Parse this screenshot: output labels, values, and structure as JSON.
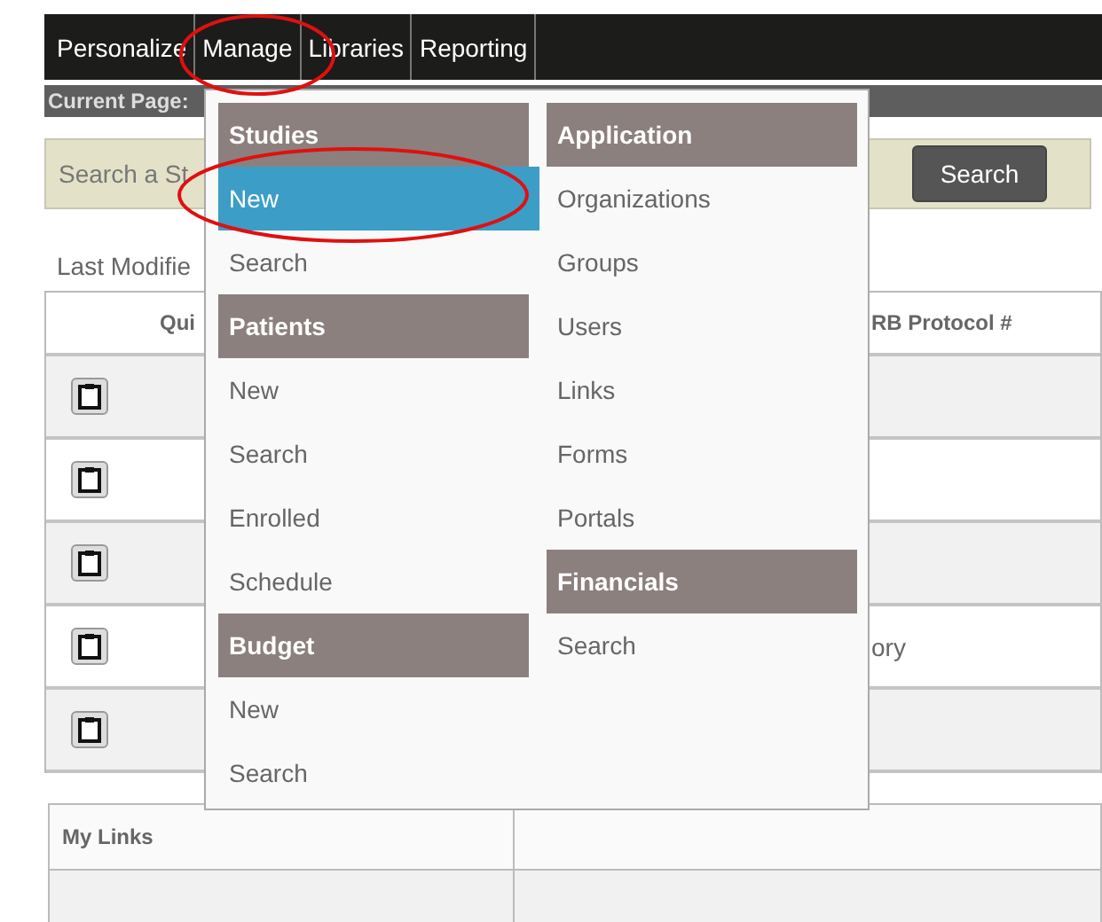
{
  "nav": {
    "items": [
      "Personalize",
      "Manage",
      "Libraries",
      "Reporting"
    ]
  },
  "current_page": {
    "label": "Current Page:"
  },
  "search": {
    "placeholder": "Search a St",
    "button": "Search"
  },
  "last_modified": "Last Modifie",
  "table": {
    "columns": [
      "Qui",
      "RB Protocol #"
    ],
    "rows": [
      {},
      {},
      {},
      {
        "column_2": "ory"
      },
      {}
    ]
  },
  "menu": {
    "columns": [
      [
        {
          "heading": "Studies",
          "items": [
            {
              "label": "New",
              "selected": true
            },
            {
              "label": "Search",
              "selected": false
            }
          ]
        },
        {
          "heading": "Patients",
          "items": [
            {
              "label": "New",
              "selected": false
            },
            {
              "label": "Search",
              "selected": false
            },
            {
              "label": "Enrolled",
              "selected": false
            },
            {
              "label": "Schedule",
              "selected": false
            }
          ]
        },
        {
          "heading": "Budget",
          "items": [
            {
              "label": "New",
              "selected": false
            },
            {
              "label": "Search",
              "selected": false
            }
          ]
        }
      ],
      [
        {
          "heading": "Application",
          "items": [
            {
              "label": "Organizations",
              "selected": false
            },
            {
              "label": "Groups",
              "selected": false
            },
            {
              "label": "Users",
              "selected": false
            },
            {
              "label": "Links",
              "selected": false
            },
            {
              "label": "Forms",
              "selected": false
            },
            {
              "label": "Portals",
              "selected": false
            }
          ]
        },
        {
          "heading": "Financials",
          "items": [
            {
              "label": "Search",
              "selected": false
            }
          ]
        }
      ]
    ]
  },
  "my_links": {
    "title": "My Links"
  }
}
